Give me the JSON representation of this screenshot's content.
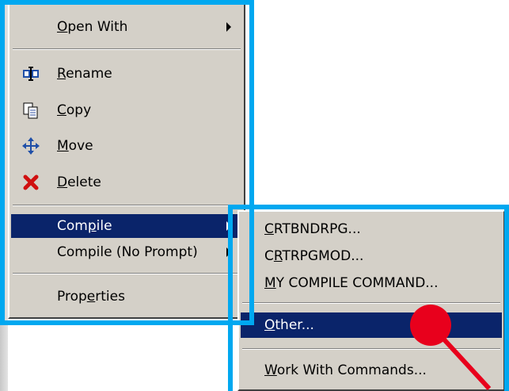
{
  "main_menu": {
    "items": [
      {
        "label": "Open With",
        "underline": "O",
        "rest": "pen With",
        "has_submenu": true
      },
      {
        "label": "Rename",
        "underline": "R",
        "rest": "ename",
        "icon": "rename-icon"
      },
      {
        "label": "Copy",
        "underline": "C",
        "rest": "opy",
        "icon": "copy-icon"
      },
      {
        "label": "Move",
        "underline": "M",
        "rest": "ove",
        "icon": "move-icon"
      },
      {
        "label": "Delete",
        "underline": "D",
        "rest": "elete",
        "icon": "delete-icon"
      },
      {
        "label": "Compile",
        "pre": "Com",
        "underline": "p",
        "rest": "ile",
        "has_submenu": true,
        "selected": true
      },
      {
        "label": "Compile (No Prompt)",
        "has_submenu": true
      },
      {
        "label": "Properties",
        "pre": "Prop",
        "underline": "e",
        "rest": "rties"
      }
    ]
  },
  "submenu": {
    "items": [
      {
        "label": "CRTBNDRPG...",
        "underline": "C",
        "rest": "RTBNDRPG..."
      },
      {
        "label": "CRTRPGMOD...",
        "pre": "C",
        "underline": "R",
        "rest": "TRPGMOD..."
      },
      {
        "label": "MY COMPILE COMMAND...",
        "underline": "M",
        "rest": "Y COMPILE COMMAND..."
      },
      {
        "label": "Other...",
        "underline": "O",
        "rest": "ther...",
        "selected": true
      },
      {
        "label": "Work With Commands...",
        "underline": "W",
        "rest": "ork With Commands..."
      }
    ]
  },
  "colors": {
    "highlight_border": "#00a8f0",
    "menu_bg": "#d4d0c8",
    "selection_bg": "#0a246a",
    "cursor_marker": "#e8001c"
  }
}
